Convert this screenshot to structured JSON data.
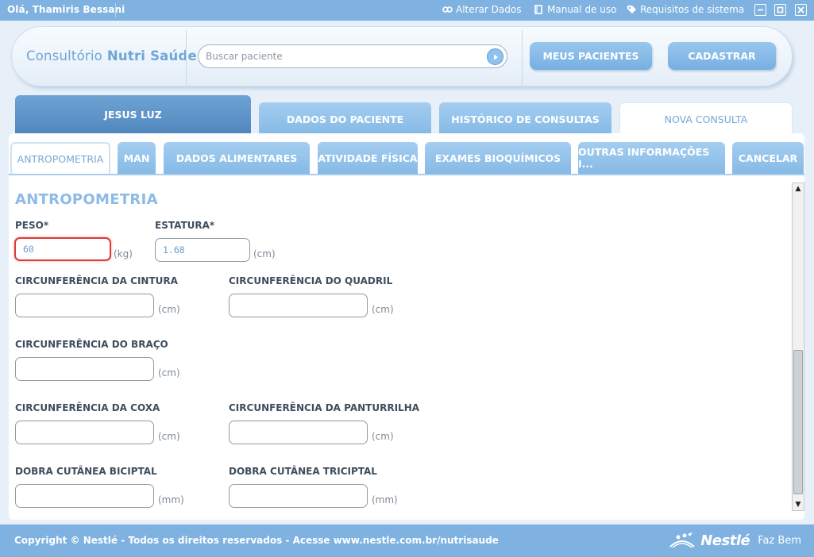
{
  "topbar": {
    "greeting": "Olá, Thamiris Bessani",
    "links": [
      {
        "label": "Alterar Dados",
        "icon": "link-icon"
      },
      {
        "label": "Manual de uso",
        "icon": "book-icon"
      },
      {
        "label": "Requisitos de sistema",
        "icon": "tag-icon"
      }
    ],
    "window_controls": [
      "minimize-icon",
      "maximize-icon",
      "close-icon"
    ]
  },
  "header": {
    "logo_prefix": "Consultório",
    "logo_main": "Nutri Saúde",
    "search_placeholder": "Buscar paciente",
    "btn_patients": "MEUS PACIENTES",
    "btn_register": "CADASTRAR"
  },
  "patient_tabs": {
    "name": "JESUS LUZ",
    "tab1": "DADOS DO PACIENTE",
    "tab2": "HISTÓRICO DE CONSULTAS",
    "tab3": "NOVA CONSULTA"
  },
  "subtabs": {
    "antropometria": "ANTROPOMETRIA",
    "man": "MAN",
    "dados_alimentares": "DADOS ALIMENTARES",
    "atividade_fisica": "ATIVIDADE FÍSICA",
    "exames": "EXAMES BIOQUÍMICOS",
    "outras": "OUTRAS INFORMAÇÕES I...",
    "cancelar": "CANCELAR"
  },
  "form": {
    "title": "ANTROPOMETRIA",
    "peso": {
      "label": "PESO*",
      "value": "60",
      "unit": "(kg)"
    },
    "estatura": {
      "label": "ESTATURA*",
      "value": "1.68",
      "unit": "(cm)"
    },
    "cintura": {
      "label": "CIRCUNFERÊNCIA DA CINTURA",
      "value": "",
      "unit": "(cm)"
    },
    "quadril": {
      "label": "CIRCUNFERÊNCIA DO QUADRIL",
      "value": "",
      "unit": "(cm)"
    },
    "braco": {
      "label": "CIRCUNFERÊNCIA DO BRAÇO",
      "value": "",
      "unit": "(cm)"
    },
    "coxa": {
      "label": "CIRCUNFERÊNCIA DA COXA",
      "value": "",
      "unit": "(cm)"
    },
    "panturrilha": {
      "label": "CIRCUNFERÊNCIA DA PANTURRILHA",
      "value": "",
      "unit": "(cm)"
    },
    "biciptal": {
      "label": "DOBRA CUTÂNEA BICIPTAL",
      "value": "",
      "unit": "(mm)"
    },
    "triciptal": {
      "label": "DOBRA CUTÂNEA TRICIPTAL",
      "value": "",
      "unit": "(mm)"
    }
  },
  "footer": {
    "copyright": "Copyright © Nestlé - Todos os direitos reservados - Acesse www.nestle.com.br/nutrisaude",
    "brand": "Nestlé",
    "tagline": "Faz Bem"
  },
  "colors": {
    "bar_blue": "#7fb2e0",
    "accent_blue": "#76a9d8",
    "error_red": "#e03a3a"
  }
}
